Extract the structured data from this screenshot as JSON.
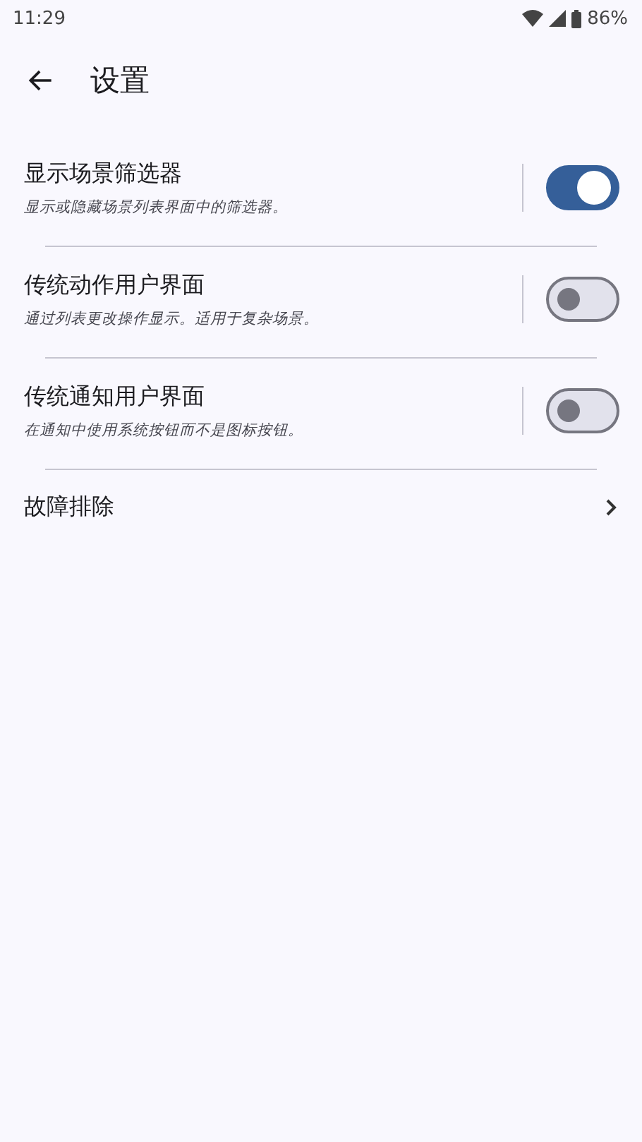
{
  "status_bar": {
    "time": "11:29",
    "battery": "86%"
  },
  "header": {
    "title": "设置"
  },
  "settings": [
    {
      "kind": "switch",
      "title": "显示场景筛选器",
      "subtitle": "显示或隐藏场景列表界面中的筛选器。",
      "on": true
    },
    {
      "kind": "switch",
      "title": "传统动作用户界面",
      "subtitle": "通过列表更改操作显示。适用于复杂场景。",
      "on": false
    },
    {
      "kind": "switch",
      "title": "传统通知用户界面",
      "subtitle": "在通知中使用系统按钮而不是图标按钮。",
      "on": false
    },
    {
      "kind": "link",
      "title": "故障排除"
    }
  ]
}
